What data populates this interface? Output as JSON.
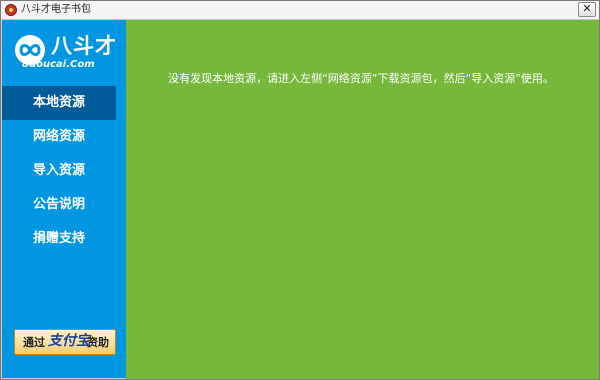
{
  "window": {
    "title": "八斗才电子书包",
    "close_label": "✕"
  },
  "logo": {
    "name": "八斗才",
    "domain": "8doucai.Com"
  },
  "sidebar": {
    "items": [
      {
        "label": "本地资源",
        "active": true
      },
      {
        "label": "网络资源",
        "active": false
      },
      {
        "label": "导入资源",
        "active": false
      },
      {
        "label": "公告说明",
        "active": false
      },
      {
        "label": "捐赠支持",
        "active": false
      }
    ],
    "donate": {
      "prefix": "通过",
      "brand": "支付宝",
      "suffix": "资助"
    }
  },
  "main": {
    "message": "没有发现本地资源，请进入左侧“网络资源”下载资源包，然后“导入资源”使用。"
  },
  "colors": {
    "sidebar": "#0096e1",
    "sidebar_active": "#005b9a",
    "content": "#75b83a"
  }
}
